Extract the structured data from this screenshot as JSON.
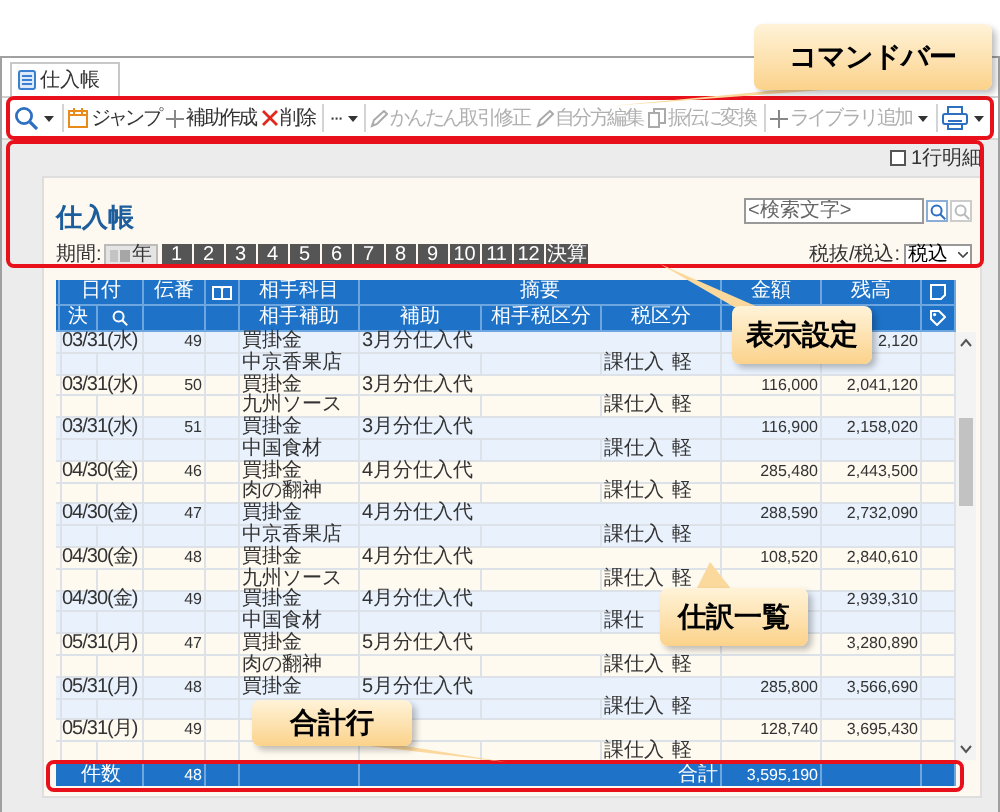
{
  "window": {
    "tab": {
      "label": "仕入帳"
    }
  },
  "toolbar": [
    {
      "kind": "search",
      "dropdown": true,
      "disabled": false
    },
    {
      "kind": "calendar",
      "label": "ジャンプ",
      "dropdown": false,
      "disabled": false
    },
    {
      "kind": "plus",
      "label": "補助作成",
      "dropdown": false,
      "disabled": false
    },
    {
      "kind": "cross",
      "label": "削除",
      "dropdown": false,
      "disabled": false
    },
    {
      "kind": "more",
      "label": "···",
      "dropdown": true,
      "disabled": false
    },
    {
      "kind": "pencil",
      "label": "かんたん取引修正",
      "dropdown": false,
      "disabled": true
    },
    {
      "kind": "pencil",
      "label": "自分方編集",
      "dropdown": false,
      "disabled": true
    },
    {
      "kind": "copy",
      "label": "振伝に変換",
      "dropdown": false,
      "disabled": true
    },
    {
      "kind": "plus",
      "label": "ライブラリ追加",
      "dropdown": true,
      "disabled": true
    },
    {
      "kind": "printer",
      "dropdown": true,
      "disabled": false
    }
  ],
  "display_settings": {
    "detail_toggle": {
      "label": "1行明細",
      "checked": false
    },
    "title": "仕入帳",
    "search": {
      "placeholder": "<検索文字>"
    },
    "period": {
      "label": "期間:",
      "year": "年",
      "months": [
        "1",
        "2",
        "3",
        "4",
        "5",
        "6",
        "7",
        "8",
        "9",
        "10",
        "11",
        "12",
        "決算"
      ]
    },
    "tax_mode": {
      "label": "税抜/税込:",
      "value": "税込"
    }
  },
  "ledger": {
    "header_top": [
      "日付",
      "伝番",
      "相手科目",
      "摘要",
      "金額",
      "残高"
    ],
    "header_bottom": [
      "決",
      "相手補助",
      "補助",
      "相手税区分",
      "税区分"
    ],
    "rows": [
      {
        "date": "03/31(水)",
        "no": "49",
        "account": "買掛金",
        "description": "3月分仕入代",
        "balance": "2,120",
        "partner": "中京香果店",
        "tax": "課仕入",
        "rate": "軽"
      },
      {
        "date": "03/31(水)",
        "no": "50",
        "account": "買掛金",
        "description": "3月分仕入代",
        "amount": "116,000",
        "balance": "2,041,120",
        "partner": "九州ソース",
        "tax": "課仕入",
        "rate": "軽"
      },
      {
        "date": "03/31(水)",
        "no": "51",
        "account": "買掛金",
        "description": "3月分仕入代",
        "amount": "116,900",
        "balance": "2,158,020",
        "partner": "中国食材",
        "tax": "課仕入",
        "rate": "軽"
      },
      {
        "date": "04/30(金)",
        "no": "46",
        "account": "買掛金",
        "description": "4月分仕入代",
        "amount": "285,480",
        "balance": "2,443,500",
        "partner": "肉の翻神",
        "tax": "課仕入",
        "rate": "軽"
      },
      {
        "date": "04/30(金)",
        "no": "47",
        "account": "買掛金",
        "description": "4月分仕入代",
        "amount": "288,590",
        "balance": "2,732,090",
        "partner": "中京香果店",
        "tax": "課仕入",
        "rate": "軽"
      },
      {
        "date": "04/30(金)",
        "no": "48",
        "account": "買掛金",
        "description": "4月分仕入代",
        "amount": "108,520",
        "balance": "2,840,610",
        "partner": "九州ソース",
        "tax": "課仕入",
        "rate": "軽"
      },
      {
        "date": "04/30(金)",
        "no": "49",
        "account": "買掛金",
        "description": "4月分仕入代",
        "balance": "2,939,310",
        "partner": "中国食材",
        "tax": "課仕"
      },
      {
        "date": "05/31(月)",
        "no": "47",
        "account": "買掛金",
        "description": "5月分仕入代",
        "balance": "3,280,890",
        "partner": "肉の翻神",
        "tax": "課仕入",
        "rate": "軽"
      },
      {
        "date": "05/31(月)",
        "no": "48",
        "account": "買掛金",
        "description": "5月分仕入代",
        "amount": "285,800",
        "balance": "3,566,690",
        "tax": "課仕入",
        "rate": "軽"
      },
      {
        "date": "05/31(月)",
        "no": "49",
        "amount": "128,740",
        "balance": "3,695,430",
        "tax": "課仕入",
        "rate": "軽"
      }
    ],
    "total": {
      "count_label": "件数",
      "count": "48",
      "sum_label": "合計",
      "amount": "3,595,190"
    }
  },
  "callouts": [
    {
      "kind": "toolbar",
      "text": "コマンドバー"
    },
    {
      "kind": "settings",
      "text": "表示設定"
    },
    {
      "kind": "list",
      "text": "仕訳一覧"
    },
    {
      "kind": "total",
      "text": "合計行"
    }
  ]
}
